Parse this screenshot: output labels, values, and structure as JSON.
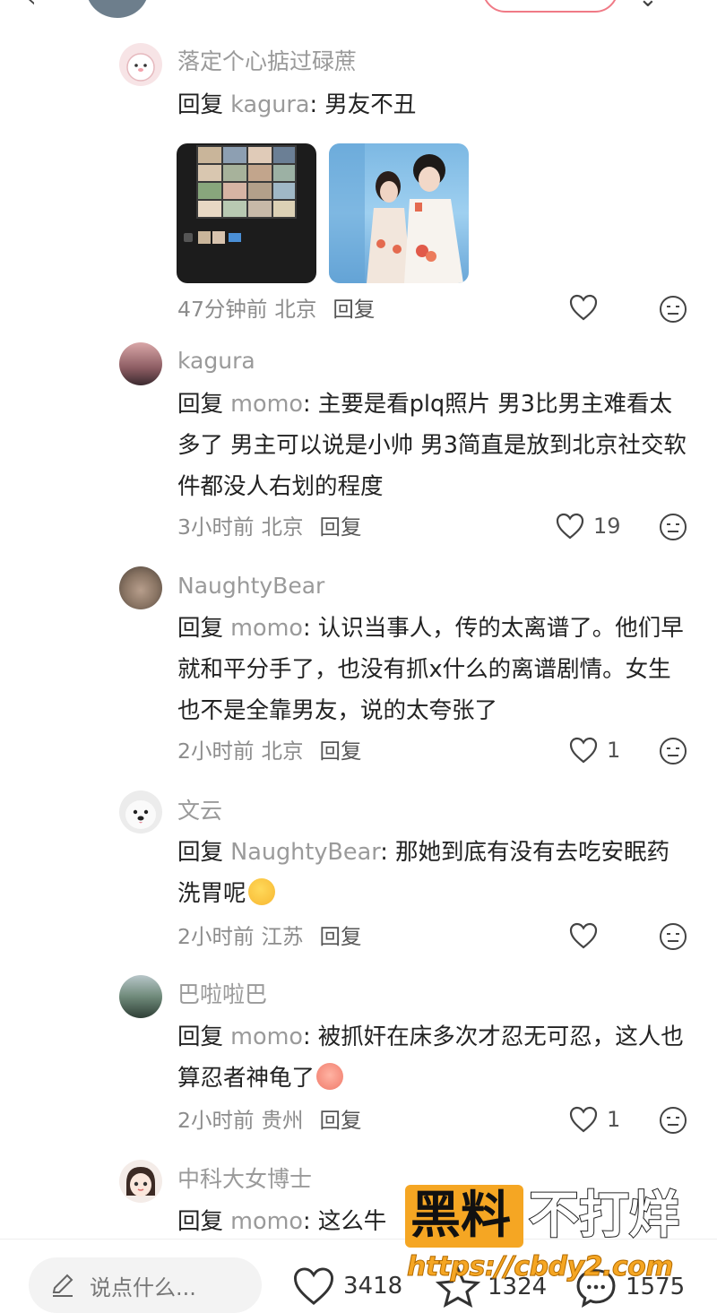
{
  "top": {
    "back": "‹",
    "more": "⌄"
  },
  "comments": [
    {
      "username": "落定个心掂过碌蔗",
      "reply_word": "回复",
      "reply_to": "kagura",
      "text": "男友不丑",
      "time": "47分钟前",
      "location": "北京",
      "reply_button": "回复",
      "likes": "",
      "images": [
        "photo-collage",
        "wedding-photo"
      ]
    },
    {
      "username": "kagura",
      "reply_word": "回复",
      "reply_to": "momo",
      "text": "主要是看plq照片 男3比男主难看太多了 男主可以说是小帅 男3简直是放到北京社交软件都没人右划的程度",
      "time": "3小时前",
      "location": "北京",
      "reply_button": "回复",
      "likes": "19"
    },
    {
      "username": "NaughtyBear",
      "reply_word": "回复",
      "reply_to": "momo",
      "text": "认识当事人，传的太离谱了。他们早就和平分手了，也没有抓x什么的离谱剧情。女生也不是全靠男友，说的太夸张了",
      "time": "2小时前",
      "location": "北京",
      "reply_button": "回复",
      "likes": "1"
    },
    {
      "username": "文云",
      "reply_word": "回复",
      "reply_to": "NaughtyBear",
      "text": "那她到底有没有去吃安眠药洗胃呢",
      "emoji": "thinking-face-emoji",
      "time": "2小时前",
      "location": "江苏",
      "reply_button": "回复",
      "likes": ""
    },
    {
      "username": "巴啦啦巴",
      "reply_word": "回复",
      "reply_to": "momo",
      "text": "被抓奸在床多次才忍无可忍，这人也算忍者神龟了",
      "emoji": "crying-face-emoji",
      "time": "2小时前",
      "location": "贵州",
      "reply_button": "回复",
      "likes": "1"
    },
    {
      "username": "中科大女博士",
      "reply_word": "回复",
      "reply_to": "momo",
      "text": "这么牛",
      "time": "",
      "location": "",
      "reply_button": "",
      "likes": ""
    }
  ],
  "bottom": {
    "input_placeholder": "说点什么...",
    "like_count": "3418",
    "star_count": "1324",
    "comment_count": "1575"
  },
  "watermark": {
    "line1_a": "黑料",
    "line1_b": "不打烊",
    "url": "https://cbdy2.com"
  },
  "colors": {
    "username": "#9a9a9a",
    "body": "#222222",
    "meta": "#8c8c8c",
    "watermark_orange": "#f5a623"
  }
}
